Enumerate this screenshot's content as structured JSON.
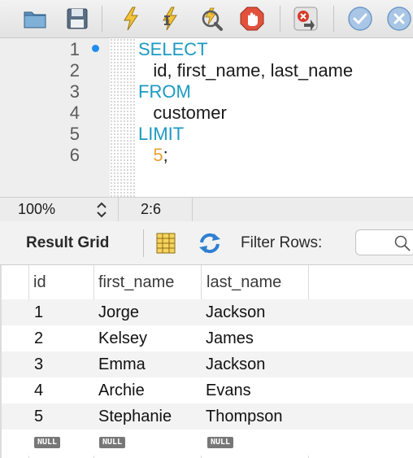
{
  "toolbar": {
    "buttons": [
      {
        "name": "open-folder-icon"
      },
      {
        "name": "save-icon"
      },
      {
        "name": "execute-lightning-icon"
      },
      {
        "name": "execute-current-icon"
      },
      {
        "name": "explain-magnifier-icon"
      },
      {
        "name": "stop-icon"
      },
      {
        "name": "toggle-stop-on-error-icon"
      },
      {
        "name": "commit-check-icon"
      },
      {
        "name": "rollback-x-icon"
      }
    ]
  },
  "editor": {
    "line_numbers": [
      "1",
      "2",
      "3",
      "4",
      "5",
      "6"
    ],
    "lines": [
      {
        "text": "SELECT",
        "kind": "keyword"
      },
      {
        "text": "   id, first_name, last_name",
        "kind": "plain"
      },
      {
        "text": "FROM",
        "kind": "keyword"
      },
      {
        "text": "   customer",
        "kind": "plain"
      },
      {
        "text": "LIMIT",
        "kind": "keyword"
      },
      {
        "text": "   5",
        "kind": "number",
        "suffix": ";"
      }
    ]
  },
  "status": {
    "zoom": "100%",
    "cursor_position": "2:6"
  },
  "result_bar": {
    "title": "Result Grid",
    "filter_label": "Filter Rows:",
    "filter_placeholder": ""
  },
  "grid": {
    "columns": [
      "id",
      "first_name",
      "last_name"
    ],
    "rows": [
      [
        "1",
        "Jorge",
        "Jackson"
      ],
      [
        "2",
        "Kelsey",
        "James"
      ],
      [
        "3",
        "Emma",
        "Jackson"
      ],
      [
        "4",
        "Archie",
        "Evans"
      ],
      [
        "5",
        "Stephanie",
        "Thompson"
      ]
    ],
    "null_label": "NULL"
  },
  "colors": {
    "keyword": "#1b9ac3",
    "number": "#e8a235",
    "breakpoint": "#1e8cf0",
    "stripe": "#f3f3f3"
  }
}
